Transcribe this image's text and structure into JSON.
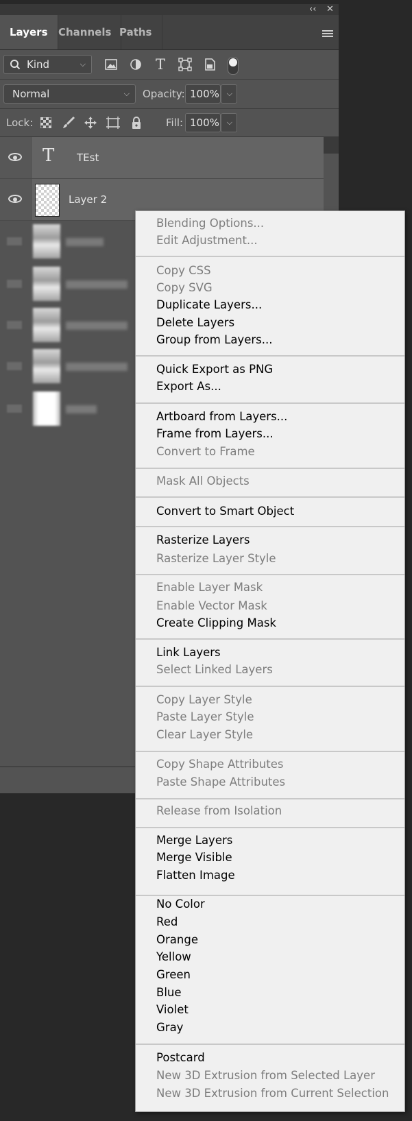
{
  "window": {
    "collapse_icon": "‹‹",
    "close_icon": "✕"
  },
  "tabs": [
    {
      "label": "Layers",
      "active": true
    },
    {
      "label": "Channels",
      "active": false
    },
    {
      "label": "Paths",
      "active": false
    }
  ],
  "filter": {
    "kind_label": "Kind"
  },
  "blend": {
    "mode": "Normal",
    "opacity_label": "Opacity:",
    "opacity_value": "100%"
  },
  "lock": {
    "label": "Lock:",
    "fill_label": "Fill:",
    "fill_value": "100%"
  },
  "layers": [
    {
      "name": "TEst",
      "type": "text"
    },
    {
      "name": "Layer 2",
      "type": "pixel"
    }
  ],
  "context_menu": {
    "items": [
      {
        "label": "Blending Options...",
        "enabled": false
      },
      {
        "label": "Edit Adjustment...",
        "enabled": false
      },
      {
        "label": "Copy CSS",
        "enabled": false
      },
      {
        "label": "Copy SVG",
        "enabled": false
      },
      {
        "label": "Duplicate Layers...",
        "enabled": true
      },
      {
        "label": "Delete Layers",
        "enabled": true
      },
      {
        "label": "Group from Layers...",
        "enabled": true
      },
      {
        "label": "Quick Export as PNG",
        "enabled": true
      },
      {
        "label": "Export As...",
        "enabled": true
      },
      {
        "label": "Artboard from Layers...",
        "enabled": true
      },
      {
        "label": "Frame from Layers...",
        "enabled": true
      },
      {
        "label": "Convert to Frame",
        "enabled": false
      },
      {
        "label": "Mask All Objects",
        "enabled": false
      },
      {
        "label": "Convert to Smart Object",
        "enabled": true
      },
      {
        "label": "Rasterize Layers",
        "enabled": true
      },
      {
        "label": "Rasterize Layer Style",
        "enabled": false
      },
      {
        "label": "Enable Layer Mask",
        "enabled": false
      },
      {
        "label": "Enable Vector Mask",
        "enabled": false
      },
      {
        "label": "Create Clipping Mask",
        "enabled": true
      },
      {
        "label": "Link Layers",
        "enabled": true
      },
      {
        "label": "Select Linked Layers",
        "enabled": false
      },
      {
        "label": "Copy Layer Style",
        "enabled": false
      },
      {
        "label": "Paste Layer Style",
        "enabled": false
      },
      {
        "label": "Clear Layer Style",
        "enabled": false
      },
      {
        "label": "Copy Shape Attributes",
        "enabled": false
      },
      {
        "label": "Paste Shape Attributes",
        "enabled": false
      },
      {
        "label": "Release from Isolation",
        "enabled": false
      },
      {
        "label": "Merge Layers",
        "enabled": true
      },
      {
        "label": "Merge Visible",
        "enabled": true
      },
      {
        "label": "Flatten Image",
        "enabled": true
      },
      {
        "label": "No Color",
        "enabled": true
      },
      {
        "label": "Red",
        "enabled": true
      },
      {
        "label": "Orange",
        "enabled": true
      },
      {
        "label": "Yellow",
        "enabled": true
      },
      {
        "label": "Green",
        "enabled": true
      },
      {
        "label": "Blue",
        "enabled": true
      },
      {
        "label": "Violet",
        "enabled": true
      },
      {
        "label": "Gray",
        "enabled": true
      },
      {
        "label": "Postcard",
        "enabled": true
      },
      {
        "label": "New 3D Extrusion from Selected Layer",
        "enabled": false
      },
      {
        "label": "New 3D Extrusion from Current Selection",
        "enabled": false
      }
    ]
  }
}
